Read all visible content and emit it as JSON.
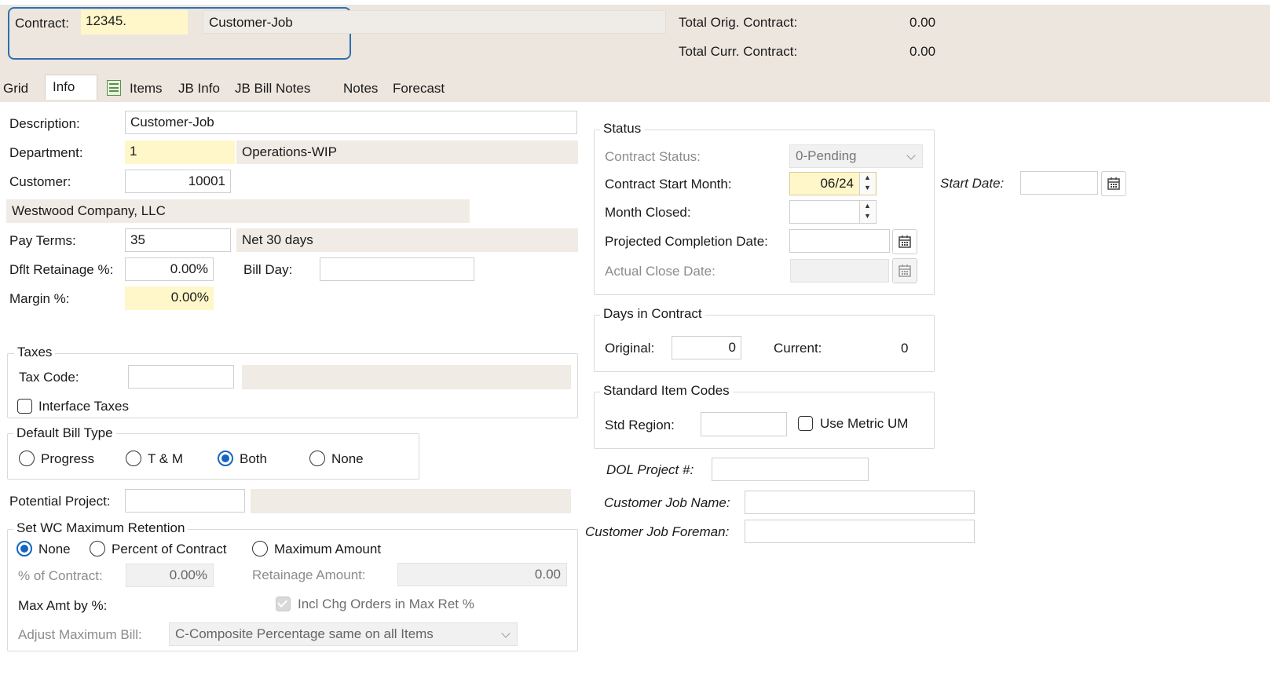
{
  "header": {
    "contract_label": "Contract:",
    "contract_value": "12345.",
    "contract_desc": "Customer-Job",
    "total_orig_label": "Total Orig. Contract:",
    "total_orig_value": "0.00",
    "total_curr_label": "Total Curr. Contract:",
    "total_curr_value": "0.00"
  },
  "tabs": [
    "Grid",
    "Info",
    "Items",
    "JB Info",
    "JB Bill Notes",
    "Notes",
    "Forecast"
  ],
  "active_tab": "Info",
  "info": {
    "description_label": "Description:",
    "description_value": "Customer-Job",
    "department_label": "Department:",
    "department_value": "1",
    "department_name": "Operations-WIP",
    "customer_label": "Customer:",
    "customer_value": "10001",
    "customer_name": "Westwood Company, LLC",
    "pay_terms_label": "Pay Terms:",
    "pay_terms_value": "35",
    "pay_terms_desc": "Net 30 days",
    "retainage_label": "Dflt Retainage %:",
    "retainage_value": "0.00%",
    "bill_day_label": "Bill Day:",
    "bill_day_value": "",
    "margin_label": "Margin %:",
    "margin_value": "0.00%"
  },
  "taxes": {
    "title": "Taxes",
    "tax_code_label": "Tax Code:",
    "tax_code_value": "",
    "interface_label": "Interface Taxes",
    "interface_checked": false
  },
  "bill_type": {
    "title": "Default Bill Type",
    "options": [
      "Progress",
      "T & M",
      "Both",
      "None"
    ],
    "selected": "Both"
  },
  "potential_project_label": "Potential Project:",
  "wc_retention": {
    "title": "Set WC Maximum Retention",
    "options": [
      "None",
      "Percent of Contract",
      "Maximum Amount"
    ],
    "selected": "None",
    "pct_contract_label": "% of Contract:",
    "pct_contract_value": "0.00%",
    "retainage_amount_label": "Retainage Amount:",
    "retainage_amount_value": "0.00",
    "max_amt_label": "Max Amt by %:",
    "incl_chg_label": "Incl Chg Orders in Max Ret %",
    "adjust_label": "Adjust Maximum Bill:",
    "adjust_value": "C-Composite Percentage same on all Items"
  },
  "status": {
    "title": "Status",
    "contract_status_label": "Contract Status:",
    "contract_status_value": "0-Pending",
    "start_month_label": "Contract Start Month:",
    "start_month_value": "06/24",
    "month_closed_label": "Month Closed:",
    "month_closed_value": "",
    "projected_label": "Projected Completion Date:",
    "actual_close_label": "Actual Close Date:",
    "start_date_label": "Start Date:"
  },
  "days": {
    "title": "Days in Contract",
    "original_label": "Original:",
    "original_value": "0",
    "current_label": "Current:",
    "current_value": "0"
  },
  "std_codes": {
    "title": "Standard Item Codes",
    "region_label": "Std Region:",
    "metric_label": "Use Metric UM"
  },
  "dol_label": "DOL Project #:",
  "cust_job_name_label": "Customer Job Name:",
  "cust_job_foreman_label": "Customer Job Foreman:",
  "colors": {
    "header_bg": "#ece6df",
    "required_bg": "#fff7c9",
    "focus_border": "#2e6fb0",
    "radio_accent": "#1565c0"
  }
}
